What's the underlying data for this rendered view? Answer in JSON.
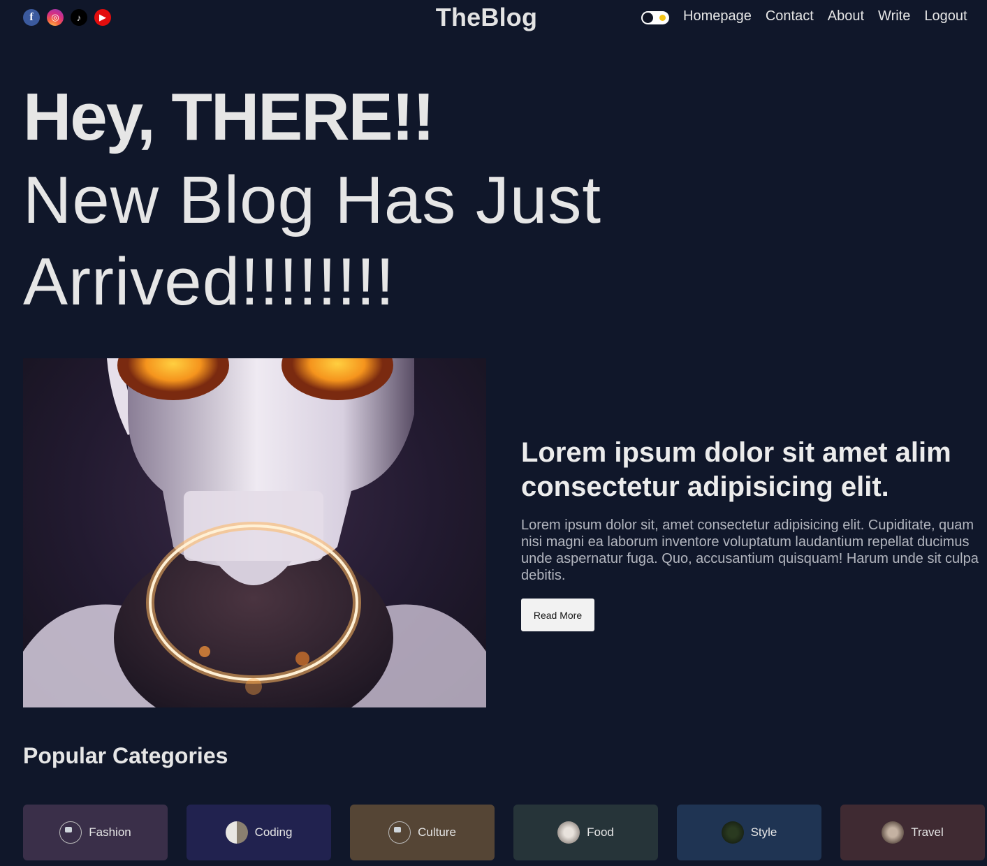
{
  "socials": [
    {
      "icon": "facebook-icon",
      "glyph": "f"
    },
    {
      "icon": "instagram-icon",
      "glyph": "◎"
    },
    {
      "icon": "tiktok-icon",
      "glyph": "♪"
    },
    {
      "icon": "youtube-icon",
      "glyph": "▶"
    }
  ],
  "header": {
    "logo": "TheBlog",
    "nav": [
      "Homepage",
      "Contact",
      "About",
      "Write",
      "Logout"
    ]
  },
  "hero": {
    "strong": "Hey, THERE!!",
    "light_line1": "New Blog Has Just",
    "light_line2": "Arrived!!!!!!!!"
  },
  "featured": {
    "image_alt": "white robot with glowing orange eyes and glowing ring",
    "title": "Lorem ipsum dolor sit amet alim consectetur adipisicing elit.",
    "description": "Lorem ipsum dolor sit, amet consectetur adipisicing elit. Cupiditate, quam nisi magni ea laborum inventore voluptatum laudantium repellat ducimus unde aspernatur fuga. Quo, accusantium quisquam! Harum unde sit culpa debitis.",
    "read_more": "Read More"
  },
  "categories": {
    "heading": "Popular Categories",
    "items": [
      {
        "label": "Fashion",
        "color": "#3a2f49",
        "thumb": "broken"
      },
      {
        "label": "Coding",
        "color": "#21224f",
        "thumb": "coding"
      },
      {
        "label": "Culture",
        "color": "#554535",
        "thumb": "broken"
      },
      {
        "label": "Food",
        "color": "#263439",
        "thumb": "food"
      },
      {
        "label": "Style",
        "color": "#1f3453",
        "thumb": "style"
      },
      {
        "label": "Travel",
        "color": "#3f2a32",
        "thumb": "travel"
      }
    ]
  },
  "colors": {
    "background": "#10172a",
    "accent_toggle": "#f5c518"
  }
}
